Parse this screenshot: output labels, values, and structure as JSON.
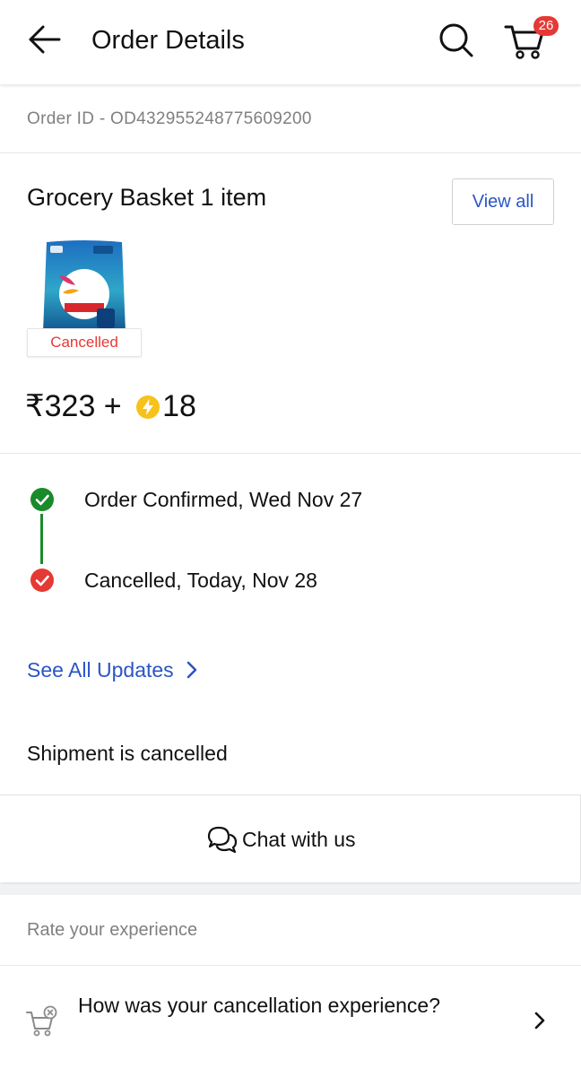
{
  "header": {
    "title": "Order Details",
    "back_icon": "arrow-left-icon",
    "search_icon": "search-icon",
    "cart_icon": "cart-icon",
    "cart_count": "26"
  },
  "order": {
    "id_text": "Order ID - OD432955248775609200"
  },
  "basket": {
    "title": "Grocery Basket 1 item",
    "view_all_label": "View all",
    "item_status": "Cancelled",
    "price": "₹323 +",
    "supercoins": "18"
  },
  "timeline": [
    {
      "text": "Order Confirmed, Wed Nov 27",
      "state": "done",
      "color": "#1a8a2b"
    },
    {
      "text": "Cancelled, Today, Nov 28",
      "state": "cancelled",
      "color": "#e53935"
    }
  ],
  "updates": {
    "see_all_label": "See All Updates"
  },
  "shipment": {
    "status_text": "Shipment is cancelled"
  },
  "chat": {
    "label": "Chat with us",
    "icon": "chat-bubbles-icon"
  },
  "rating": {
    "section_title": "Rate your experience",
    "question": "How was your cancellation experience?",
    "icon": "cart-cancel-icon"
  },
  "colors": {
    "link_blue": "#2a55c5",
    "cancel_red": "#e53935",
    "confirm_green": "#1a8a2b",
    "badge_red": "#e53935"
  }
}
